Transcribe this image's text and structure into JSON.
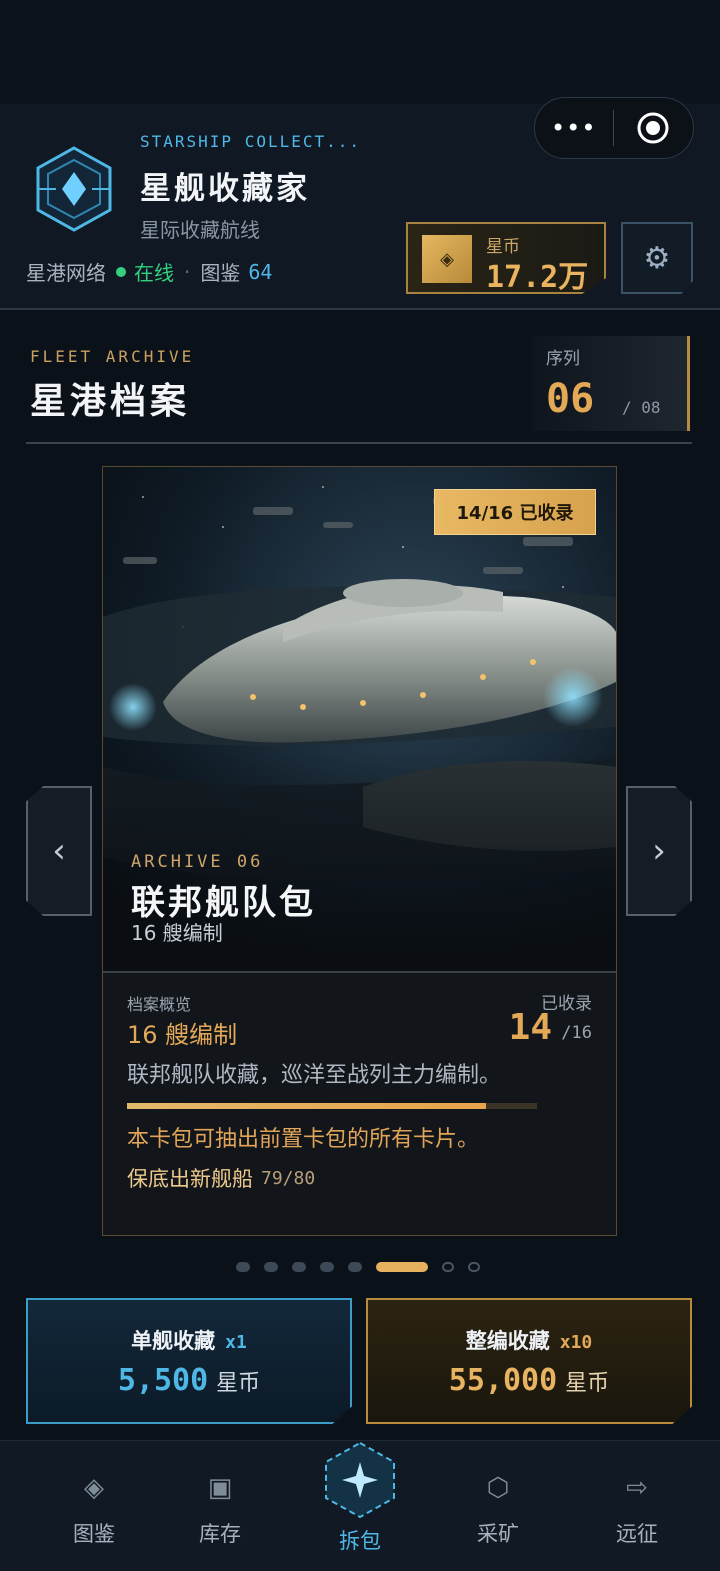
{
  "header": {
    "subtitle_en": "STARSHIP COLLECT...",
    "title": "星舰收藏家",
    "tagline": "星际收藏航线",
    "network_label": "星港网络",
    "status": "在线",
    "dex_label": "图鉴",
    "dex_count": "64",
    "more_icon": "more-dots-icon",
    "target_icon": "target-icon"
  },
  "coins": {
    "label": "星币",
    "value": "17.2万",
    "icon": "coin-diamond-icon"
  },
  "settings_icon": "gear-icon",
  "section": {
    "title_en": "FLEET ARCHIVE",
    "title": "星港档案",
    "seq_label": "序列",
    "seq_current": "06",
    "seq_total": "/ 08"
  },
  "card": {
    "badge": "14/16 已收录",
    "archive_en": "ARCHIVE 06",
    "title": "联邦舰队包",
    "fleet_size": "16 艘编制",
    "overview_label": "档案概览",
    "overview_value": "16 艘编制",
    "collected_label": "已收录",
    "collected_count": "14",
    "collected_total": "/16",
    "collected_progress": 0.875,
    "description": "联邦舰队收藏，巡洋至战列主力编制。",
    "note": "本卡包可抽出前置卡包的所有卡片。",
    "pity_label": "保底出新舰船",
    "pity_value": "79/80"
  },
  "pager": {
    "total": 8,
    "active": 6,
    "prev_icon": "chevron-left-icon",
    "next_icon": "chevron-right-icon"
  },
  "actions": {
    "single_label": "单舰收藏",
    "single_mult": "x1",
    "single_price": "5,500",
    "single_unit": "星币",
    "full_label": "整编收藏",
    "full_mult": "x10",
    "full_price": "55,000",
    "full_unit": "星币"
  },
  "nav": {
    "items": [
      {
        "label": "图鉴",
        "icon": "diamond-icon"
      },
      {
        "label": "库存",
        "icon": "box-icon"
      },
      {
        "label": "拆包",
        "icon": "star-hex-icon"
      },
      {
        "label": "采矿",
        "icon": "hexagon-icon"
      },
      {
        "label": "远征",
        "icon": "arrow-right-icon"
      }
    ],
    "active": 2
  },
  "colors": {
    "accent_blue": "#4fb7e6",
    "accent_gold": "#e3a957",
    "online_green": "#35d07f",
    "background": "#0b1119"
  }
}
